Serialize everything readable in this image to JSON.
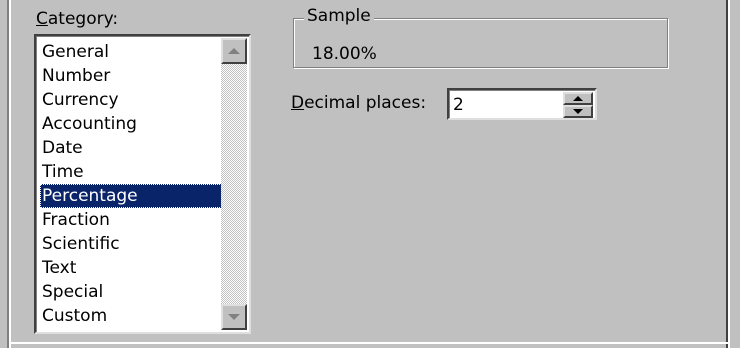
{
  "category": {
    "label_accel": "C",
    "label_rest": "ategory:",
    "items": [
      "General",
      "Number",
      "Currency",
      "Accounting",
      "Date",
      "Time",
      "Percentage",
      "Fraction",
      "Scientific",
      "Text",
      "Special",
      "Custom"
    ],
    "selected": "Percentage"
  },
  "sample": {
    "caption": "Sample",
    "value": "18.00%"
  },
  "decimal_places": {
    "label_accel": "D",
    "label_rest": "ecimal places:",
    "value": "2"
  },
  "colors": {
    "dialog_face": "#c0c0c0",
    "selection_bg": "#0a246a",
    "selection_text": "#ffffff"
  },
  "icons": {
    "scroll_up": "scroll-up-arrow-icon",
    "scroll_down": "scroll-down-arrow-icon",
    "spin_up": "spin-up-arrow-icon",
    "spin_down": "spin-down-arrow-icon"
  }
}
